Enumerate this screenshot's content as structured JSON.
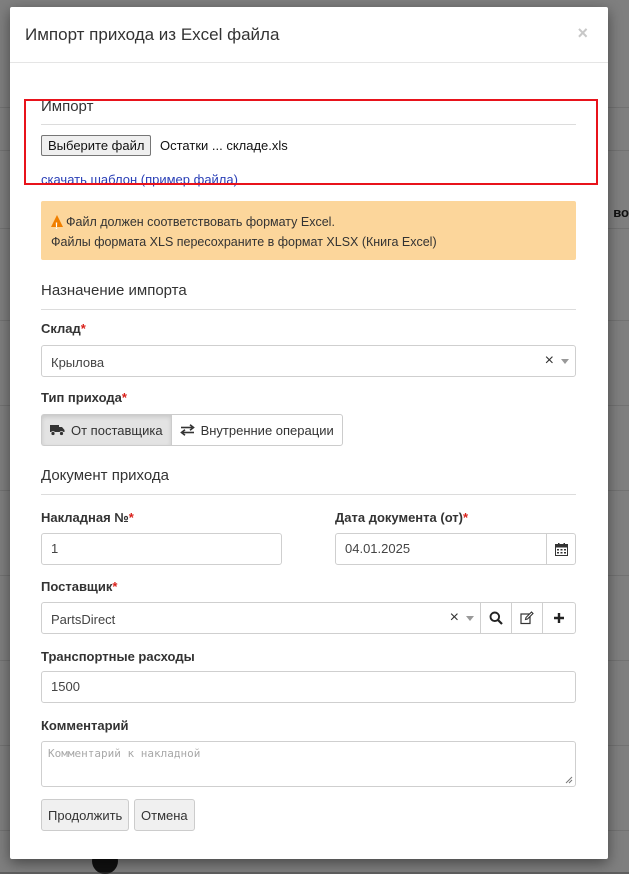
{
  "modal": {
    "title": "Импорт прихода из Excel файла",
    "close": "×"
  },
  "import_section": {
    "title": "Импорт",
    "file_button": "Выберите файл",
    "file_name": "Остатки ... складе.xls",
    "template_link": "скачать шаблон (пример файла)"
  },
  "alert": {
    "line1": "Файл должен соответствовать формату Excel.",
    "line2": "Файлы формата XLS пересохраните в формат XLSX (Книга Excel)"
  },
  "destination": {
    "title": "Назначение импорта",
    "warehouse_label": "Склад",
    "warehouse_value": "Крылова",
    "type_label": "Тип прихода",
    "type_options": [
      "От поставщика",
      "Внутренние операции"
    ],
    "type_selected": "От поставщика"
  },
  "document": {
    "title": "Документ прихода",
    "invoice_label": "Накладная №",
    "invoice_value": "1",
    "date_label": "Дата документа (от)",
    "date_value": "04.01.2025",
    "supplier_label": "Поставщик",
    "supplier_value": "PartsDirect",
    "transport_label": "Транспортные расходы",
    "transport_value": "1500",
    "comment_label": "Комментарий",
    "comment_placeholder": "Комментарий к накладной"
  },
  "actions": {
    "continue": "Продолжить",
    "cancel": "Отмена"
  },
  "required_mark": "*",
  "clear_mark": "×",
  "background": {
    "right_text": "во"
  },
  "colors": {
    "highlight": "#e8131b",
    "alert_bg": "#fcd69b",
    "warning_icon": "#f07f00",
    "link": "#2a3fb6",
    "required": "#d9201a"
  }
}
